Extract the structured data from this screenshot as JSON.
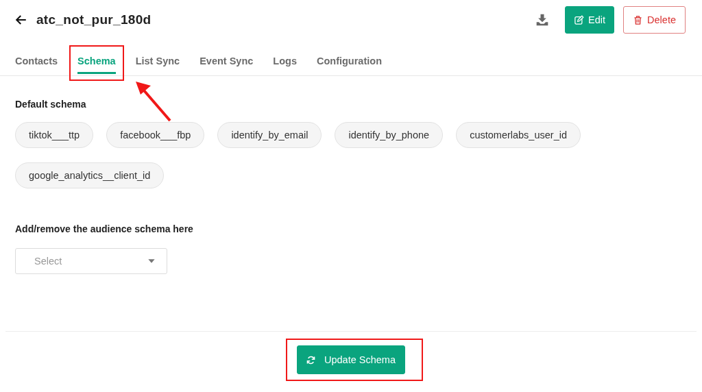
{
  "header": {
    "title": "atc_not_pur_180d",
    "actions": [
      {
        "kind": "download"
      },
      {
        "kind": "primary",
        "label": "Edit"
      },
      {
        "kind": "danger",
        "label": "Delete"
      }
    ]
  },
  "tabs": [
    {
      "label": "Contacts",
      "selected": false,
      "highlighted": false
    },
    {
      "label": "Schema",
      "selected": true,
      "highlighted": true
    },
    {
      "label": "List Sync",
      "selected": false,
      "highlighted": false
    },
    {
      "label": "Event Sync",
      "selected": false,
      "highlighted": false
    },
    {
      "label": "Logs",
      "selected": false,
      "highlighted": false
    },
    {
      "label": "Configuration",
      "selected": false,
      "highlighted": false
    }
  ],
  "default_schema": {
    "label": "Default schema",
    "chips": [
      "tiktok___ttp",
      "facebook___fbp",
      "identify_by_email",
      "identify_by_phone",
      "customerlabs_user_id",
      "google_analytics__client_id"
    ]
  },
  "audience_schema": {
    "label": "Add/remove the audience schema here",
    "select": {
      "placeholder": "Select"
    }
  },
  "update_button": {
    "label": "Update Schema",
    "highlighted": true
  },
  "annotation_arrow": true
}
